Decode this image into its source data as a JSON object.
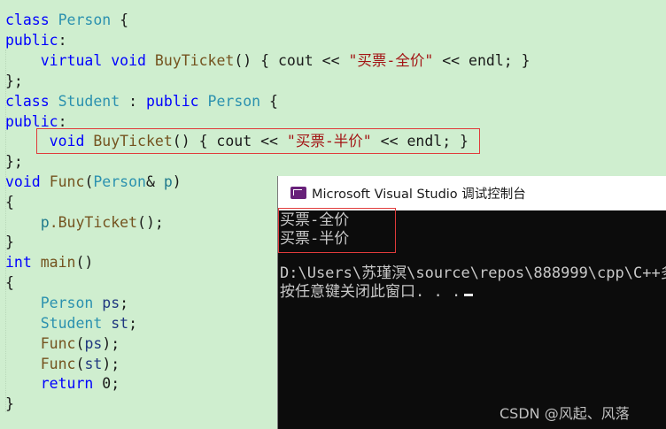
{
  "code": {
    "l1": {
      "kw": "class",
      "name": "Person",
      "rest": " {"
    },
    "l2": {
      "kw": "public",
      "rest": ":"
    },
    "l3": {
      "indent": "    ",
      "kw1": "virtual",
      "kw2": "void",
      "fn": "BuyTicket",
      "mid": "() { cout << ",
      "str": "\"买票-全价\"",
      "tail": " << endl; }"
    },
    "l4": {
      "text": "};"
    },
    "l5": {
      "kw": "class",
      "name": "Student",
      "mid": " : ",
      "kw2": "public",
      "base": "Person",
      "rest": " {"
    },
    "l6": {
      "kw": "public",
      "rest": ":"
    },
    "l7": {
      "indent": "     ",
      "kw": "void",
      "fn": "BuyTicket",
      "mid": "() { cout << ",
      "str": "\"买票-半价\"",
      "tail": " << endl; }"
    },
    "l8": {
      "text": "};"
    },
    "l9": {
      "kw": "void",
      "fn": "Func",
      "open": "(",
      "type": "Person",
      "amp": "& ",
      "param": "p",
      "close": ")"
    },
    "l10": {
      "text": "{"
    },
    "l11": {
      "indent": "    ",
      "obj": "p",
      "call": ".BuyTicket",
      "rest": "();"
    },
    "l12": {
      "text": "}"
    },
    "l13": {
      "kw": "int",
      "fn": "main",
      "rest": "()"
    },
    "l14": {
      "text": "{"
    },
    "l15": {
      "indent": "    ",
      "type": "Person",
      "var": "ps",
      "rest": ";"
    },
    "l16": {
      "indent": "    ",
      "type": "Student",
      "var": "st",
      "rest": ";"
    },
    "l17": {
      "indent": "    ",
      "fn": "Func",
      "open": "(",
      "var": "ps",
      "close": ");"
    },
    "l18": {
      "indent": "    ",
      "fn": "Func",
      "open": "(",
      "var": "st",
      "close": ");"
    },
    "l19": {
      "indent": "    ",
      "kw": "return",
      "rest": " 0;"
    },
    "l20": {
      "text": "}"
    }
  },
  "console": {
    "title": "Microsoft Visual Studio 调试控制台",
    "output": [
      "买票-全价",
      "买票-半价"
    ],
    "path": "D:\\Users\\苏瑾溟\\source\\repos\\888999\\cpp\\C++多",
    "prompt": "按任意键关闭此窗口. . ."
  },
  "watermark": "CSDN @风起、风落",
  "colors": {
    "editor_bg": "#cfeecf",
    "keyword": "#0000ff",
    "type": "#2b91af",
    "string": "#a31515",
    "highlight_box": "#e03b3b",
    "console_bg": "#0c0c0c",
    "vs_icon": "#68217a"
  },
  "icons": {
    "console": "visual-studio-icon"
  }
}
